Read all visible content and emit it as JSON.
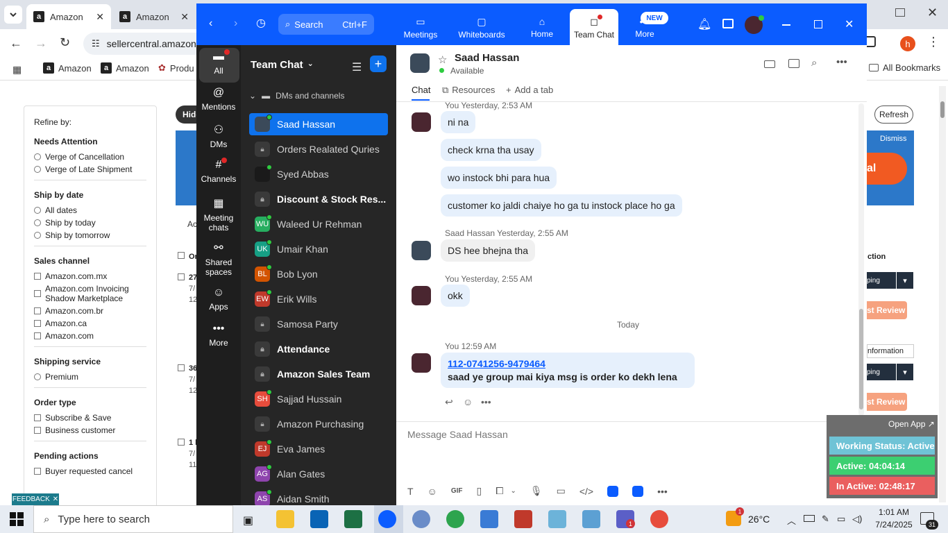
{
  "chrome": {
    "tabs": [
      {
        "label": "Amazon"
      },
      {
        "label": "Amazon"
      }
    ],
    "url": "sellercentral.amazon",
    "bookmarks": [
      {
        "label": "Amazon"
      },
      {
        "label": "Amazon"
      },
      {
        "label": "Produ"
      }
    ],
    "all_bookmarks": "All Bookmarks",
    "profile_initial": "h"
  },
  "seller": {
    "hide_label": "Hide",
    "refresh_label": "Refresh",
    "dismiss_label": "Dismiss",
    "feedback_label": "FEEDBACK",
    "refine_title": "Refine by:",
    "sections": [
      {
        "title": "Needs Attention",
        "kind": "radio",
        "options": [
          "Verge of Cancellation",
          "Verge of Late Shipment"
        ]
      },
      {
        "title": "Ship by date",
        "kind": "radio",
        "options": [
          "All dates",
          "Ship by today",
          "Ship by tomorrow"
        ]
      },
      {
        "title": "Sales channel",
        "kind": "check",
        "options": [
          "Amazon.com.mx",
          "Amazon.com Invoicing Shadow Marketplace",
          "Amazon.com.br",
          "Amazon.ca",
          "Amazon.com"
        ]
      },
      {
        "title": "Shipping service",
        "kind": "radio",
        "options": [
          "Premium"
        ]
      },
      {
        "title": "Order type",
        "kind": "check",
        "options": [
          "Subscribe & Save",
          "Business customer"
        ]
      },
      {
        "title": "Pending actions",
        "kind": "check",
        "options": [
          "Buyer requested cancel"
        ]
      }
    ],
    "partial": {
      "ac": "Ac",
      "or": "Or",
      "row1": "27",
      "row1_date": "7/",
      "row1_num": "12",
      "row2": "36",
      "row2_date": "7/",
      "row2_num": "12",
      "row3": "1 h",
      "row3_date": "7/",
      "row3_num": "11",
      "al": "al",
      "ction": "ction",
      "ping": "ping",
      "information": "nformation",
      "st_review": "st Review",
      "informati": "informati"
    }
  },
  "zoom": {
    "search_label": "Search",
    "search_shortcut": "Ctrl+F",
    "nav": [
      {
        "label": "Meetings"
      },
      {
        "label": "Whiteboards"
      },
      {
        "label": "Home"
      },
      {
        "label": "Team Chat"
      },
      {
        "label": "More"
      }
    ],
    "new_badge": "NEW",
    "rail": [
      {
        "label": "All"
      },
      {
        "label": "Mentions"
      },
      {
        "label": "DMs"
      },
      {
        "label": "Channels"
      },
      {
        "label": "Meeting chats"
      },
      {
        "label": "Shared spaces"
      },
      {
        "label": "Apps"
      },
      {
        "label": "More"
      }
    ],
    "list_title": "Team Chat",
    "section_label": "DMs and channels",
    "items": [
      {
        "name": "Saad Hassan",
        "initials": "",
        "color": "#3b4a5a"
      },
      {
        "name": "Orders Realated Quries",
        "initials": "",
        "color": "#3a3a3a"
      },
      {
        "name": "Syed Abbas",
        "initials": "",
        "color": "#1a1a1a"
      },
      {
        "name": "Discount & Stock Res...",
        "initials": "",
        "color": "#3a3a3a"
      },
      {
        "name": "Waleed Ur Rehman",
        "initials": "WU",
        "color": "#27ae60"
      },
      {
        "name": "Umair Khan",
        "initials": "UK",
        "color": "#16a085"
      },
      {
        "name": "Bob Lyon",
        "initials": "BL",
        "color": "#d35400"
      },
      {
        "name": "Erik Wills",
        "initials": "EW",
        "color": "#c0392b"
      },
      {
        "name": "Samosa Party",
        "initials": "",
        "color": "#3a3a3a"
      },
      {
        "name": "Attendance",
        "initials": "",
        "color": "#3a3a3a"
      },
      {
        "name": "Amazon Sales Team",
        "initials": "",
        "color": "#3a3a3a"
      },
      {
        "name": "Sajjad Hussain",
        "initials": "SH",
        "color": "#e74c3c"
      },
      {
        "name": "Amazon Purchasing",
        "initials": "",
        "color": "#3a3a3a"
      },
      {
        "name": "Eva James",
        "initials": "EJ",
        "color": "#c0392b"
      },
      {
        "name": "Alan Gates",
        "initials": "AG",
        "color": "#8e44ad"
      },
      {
        "name": "Aidan Smith",
        "initials": "AS",
        "color": "#8e44ad"
      }
    ],
    "chat": {
      "contact_name": "Saad Hassan",
      "status": "Available",
      "tabs": [
        "Chat",
        "Resources",
        "Add a tab"
      ],
      "msg_you_1": "You Yesterday, 2:53 AM",
      "bubbles_you_1": [
        "ni na",
        "check krna tha usay",
        "wo instock bhi para hua",
        "customer ko jaldi chaiye ho ga tu instock place ho ga"
      ],
      "msg_saad_sender": "Saad Hassan",
      "msg_saad_time": "Yesterday, 2:55 AM",
      "bubble_saad": "DS hee bhejna tha",
      "msg_you_2": "You Yesterday, 2:55 AM",
      "bubble_you_2": "okk",
      "divider": "Today",
      "msg_you_3": "You 12:59 AM",
      "order_link": "112-0741256-9479464",
      "order_note": "saad ye group mai kiya msg is order ko dekh lena",
      "composer_placeholder": "Message Saad Hassan",
      "gif_label": "GIF"
    }
  },
  "widget": {
    "open_app": "Open App ↗",
    "working_status": "Working Status: Active",
    "active": "Active: 04:04:14",
    "inactive": "In Active: 02:48:17"
  },
  "taskbar": {
    "search_placeholder": "Type here to search",
    "weather": "26°C",
    "time": "1:01 AM",
    "date": "7/24/2025",
    "notif_count": "31",
    "badge_1": "1"
  }
}
